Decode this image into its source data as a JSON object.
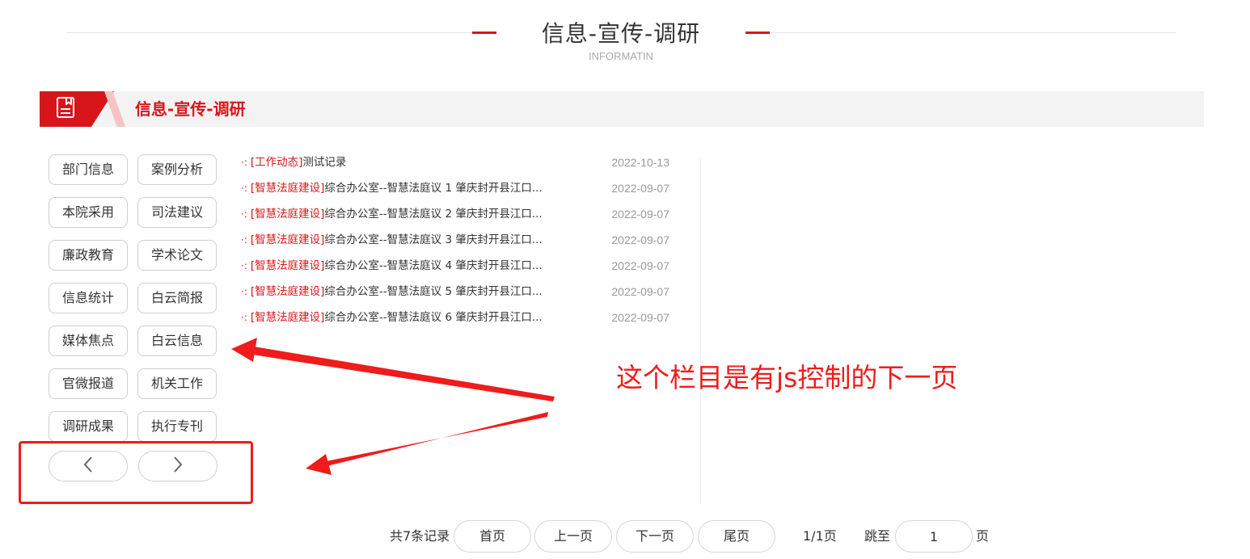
{
  "header": {
    "title": "信息-宣传-调研",
    "subtitle": "INFORMATIN",
    "accent_color": "#d7161b"
  },
  "section": {
    "title": "信息-宣传-调研",
    "icon": "document-icon"
  },
  "categories": [
    "部门信息",
    "案例分析",
    "本院采用",
    "司法建议",
    "廉政教育",
    "学术论文",
    "信息统计",
    "白云简报",
    "媒体焦点",
    "白云信息",
    "官微报道",
    "机关工作",
    "调研成果",
    "执行专刊"
  ],
  "category_pager": {
    "prev_icon": "chevron-left-icon",
    "next_icon": "chevron-right-icon"
  },
  "news": [
    {
      "bullet": "·:",
      "category": "[工作动态]",
      "title": "测试记录",
      "date": "2022-10-13"
    },
    {
      "bullet": "·:",
      "category": "[智慧法庭建设]",
      "title": "综合办公室--智慧法庭议 1 肇庆封开县江口...",
      "date": "2022-09-07"
    },
    {
      "bullet": "·:",
      "category": "[智慧法庭建设]",
      "title": "综合办公室--智慧法庭议 2 肇庆封开县江口...",
      "date": "2022-09-07"
    },
    {
      "bullet": "·:",
      "category": "[智慧法庭建设]",
      "title": "综合办公室--智慧法庭议 3 肇庆封开县江口...",
      "date": "2022-09-07"
    },
    {
      "bullet": "·:",
      "category": "[智慧法庭建设]",
      "title": "综合办公室--智慧法庭议 4 肇庆封开县江口...",
      "date": "2022-09-07"
    },
    {
      "bullet": "·:",
      "category": "[智慧法庭建设]",
      "title": "综合办公室--智慧法庭议 5 肇庆封开县江口...",
      "date": "2022-09-07"
    },
    {
      "bullet": "·:",
      "category": "[智慧法庭建设]",
      "title": "综合办公室--智慧法庭议 6 肇庆封开县江口...",
      "date": "2022-09-07"
    }
  ],
  "annotation": {
    "text": "这个栏目是有js控制的下一页",
    "color": "#ee1c1c"
  },
  "pagination": {
    "total": "共7条记录",
    "first": "首页",
    "prev": "上一页",
    "next": "下一页",
    "last": "尾页",
    "page_info": "1/1页",
    "jump_label": "跳至",
    "jump_value": "1",
    "page_unit": "页"
  }
}
